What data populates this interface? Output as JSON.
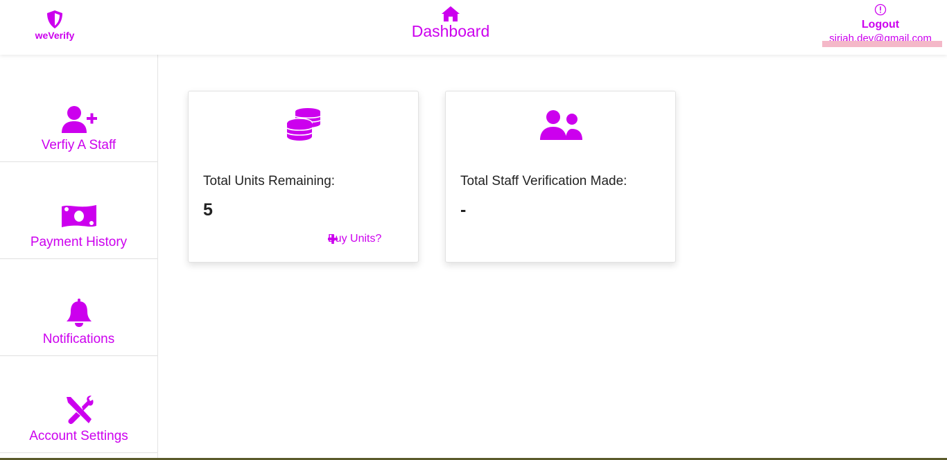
{
  "brand": {
    "name": "weVerify"
  },
  "header": {
    "title": "Dashboard",
    "logout_label": "Logout",
    "email": "sirjah.dev@gmail.com"
  },
  "sidebar": {
    "items": [
      {
        "label": "Verfiy A Staff",
        "icon": "user-plus-icon"
      },
      {
        "label": "Payment History",
        "icon": "money-bill-icon"
      },
      {
        "label": "Notifications",
        "icon": "bell-icon"
      },
      {
        "label": "Account Settings",
        "icon": "tools-icon"
      }
    ]
  },
  "cards": [
    {
      "label": "Total Units Remaining:",
      "value": "5",
      "link": "Buy Units?",
      "icon": "coins-icon"
    },
    {
      "label": "Total Staff Verification Made:",
      "value": "-",
      "icon": "users-icon"
    }
  ],
  "colors": {
    "accent": "#cc00ee",
    "text": "#222222"
  }
}
